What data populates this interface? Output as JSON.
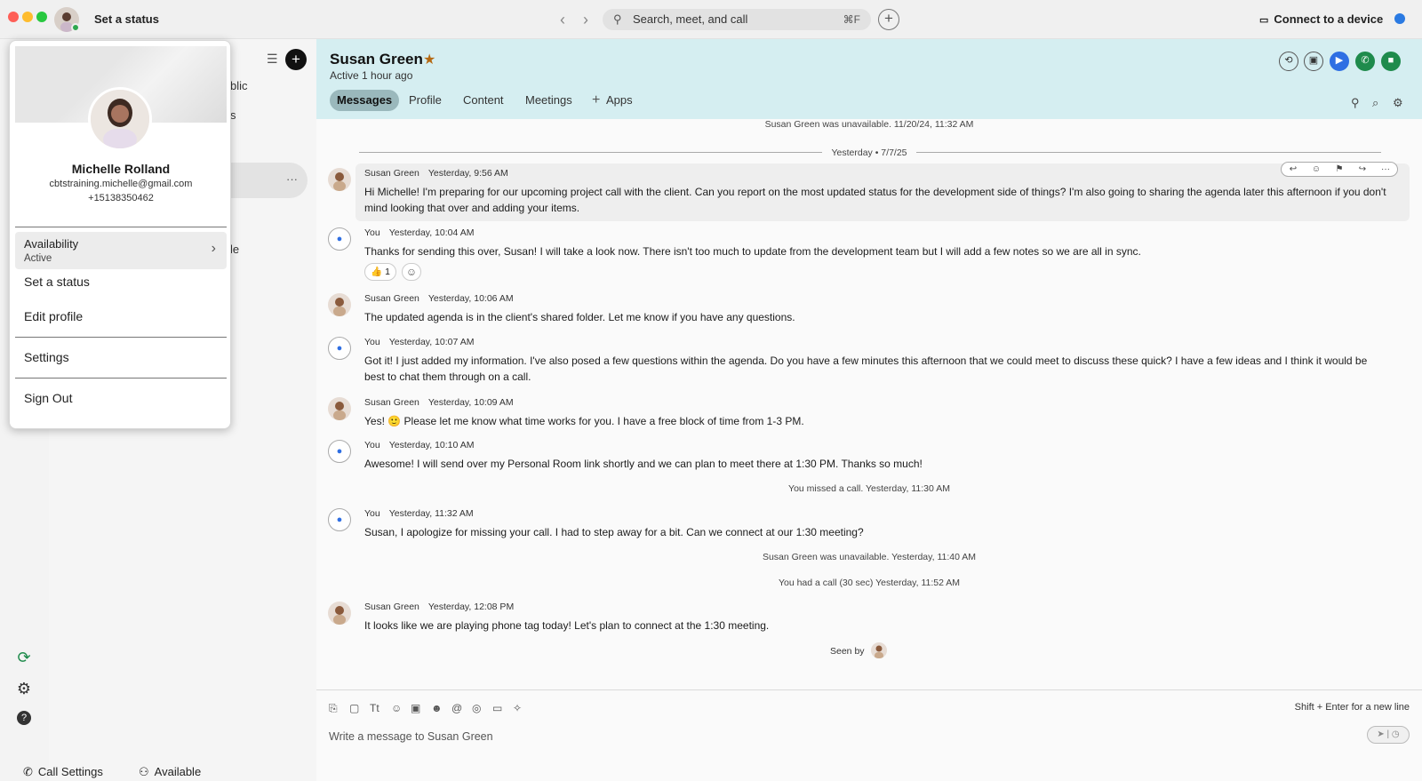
{
  "titlebar": {
    "status_link": "Set a status",
    "search_placeholder": "Search, meet, and call",
    "search_shortcut": "⌘F",
    "connect_label": "Connect to a device"
  },
  "sidebar": {
    "fragment_1": "blic",
    "fragment_2": "s",
    "fragment_3": "le",
    "more": "···",
    "bottom": {
      "call_settings": "Call Settings",
      "available": "Available"
    }
  },
  "profile_popup": {
    "name": "Michelle Rolland",
    "email": "cbtstraining.michelle@gmail.com",
    "phone": "+15138350462",
    "availability_label": "Availability",
    "availability_value": "Active",
    "items": [
      "Set a status",
      "Edit profile",
      "Settings",
      "Sign Out"
    ]
  },
  "chat": {
    "contact_name": "Susan Green",
    "status": "Active 1 hour ago",
    "tabs": [
      "Messages",
      "Profile",
      "Content",
      "Meetings",
      "Apps"
    ],
    "messages": [
      {
        "type": "system",
        "text": "Susan Green was unavailable. 11/20/24, 11:32 AM"
      },
      {
        "type": "divider",
        "text": "Yesterday • 7/7/25"
      },
      {
        "type": "msg",
        "sender": "Susan Green",
        "time": "Yesterday, 9:56 AM",
        "text": "Hi Michelle! I'm preparing for our upcoming project call with the client. Can you report on the most updated status for the development side of things? I'm also going to sharing the agenda later this afternoon if you don't mind looking that over and adding your items."
      },
      {
        "type": "msg",
        "sender": "You",
        "time": "Yesterday, 10:04 AM",
        "text": "Thanks for sending this over, Susan! I will take a look now. There isn't too much to update from the development team but I will add a few notes so we are all in sync.",
        "reaction": "👍",
        "reaction_count": "1"
      },
      {
        "type": "msg",
        "sender": "Susan Green",
        "time": "Yesterday, 10:06 AM",
        "text": "The updated agenda is in the client's shared folder. Let me know if you have any questions."
      },
      {
        "type": "msg",
        "sender": "You",
        "time": "Yesterday, 10:07 AM",
        "text": "Got it! I just added my information. I've also posed a few questions within the agenda. Do you have a few minutes this afternoon that we could meet to discuss these quick? I have a few ideas and I think it would be best to chat them through on a call."
      },
      {
        "type": "msg",
        "sender": "Susan Green",
        "time": "Yesterday, 10:09 AM",
        "text": "Yes! 🙂 Please let me know what time works for you. I have a free block of time from 1-3 PM."
      },
      {
        "type": "msg",
        "sender": "You",
        "time": "Yesterday, 10:10 AM",
        "text": "Awesome! I will send over my Personal Room link shortly and we can plan to meet there at 1:30 PM. Thanks so much!"
      },
      {
        "type": "system",
        "text": "You missed a call. Yesterday, 11:30 AM"
      },
      {
        "type": "msg",
        "sender": "You",
        "time": "Yesterday, 11:32 AM",
        "text": "Susan, I apologize for missing your call. I had to step away for a bit. Can we connect at our 1:30 meeting?"
      },
      {
        "type": "system",
        "text": "Susan Green was unavailable. Yesterday, 11:40 AM"
      },
      {
        "type": "system",
        "text": "You had a call (30 sec) Yesterday, 11:52 AM"
      },
      {
        "type": "msg",
        "sender": "Susan Green",
        "time": "Yesterday, 12:08 PM",
        "text": "It looks like we are playing phone tag today! Let's plan to connect at the 1:30 meeting."
      }
    ],
    "seen_by": "Seen by"
  },
  "compose": {
    "placeholder": "Write a message to Susan Green",
    "hint": "Shift + Enter for a new line"
  },
  "colors": {
    "header_bg": "#d5eef1",
    "active_tab": "#9ab8bc",
    "accent_blue": "#2f6fe3",
    "call_green": "#1f8b4c",
    "presence_green": "#2fa84f"
  }
}
